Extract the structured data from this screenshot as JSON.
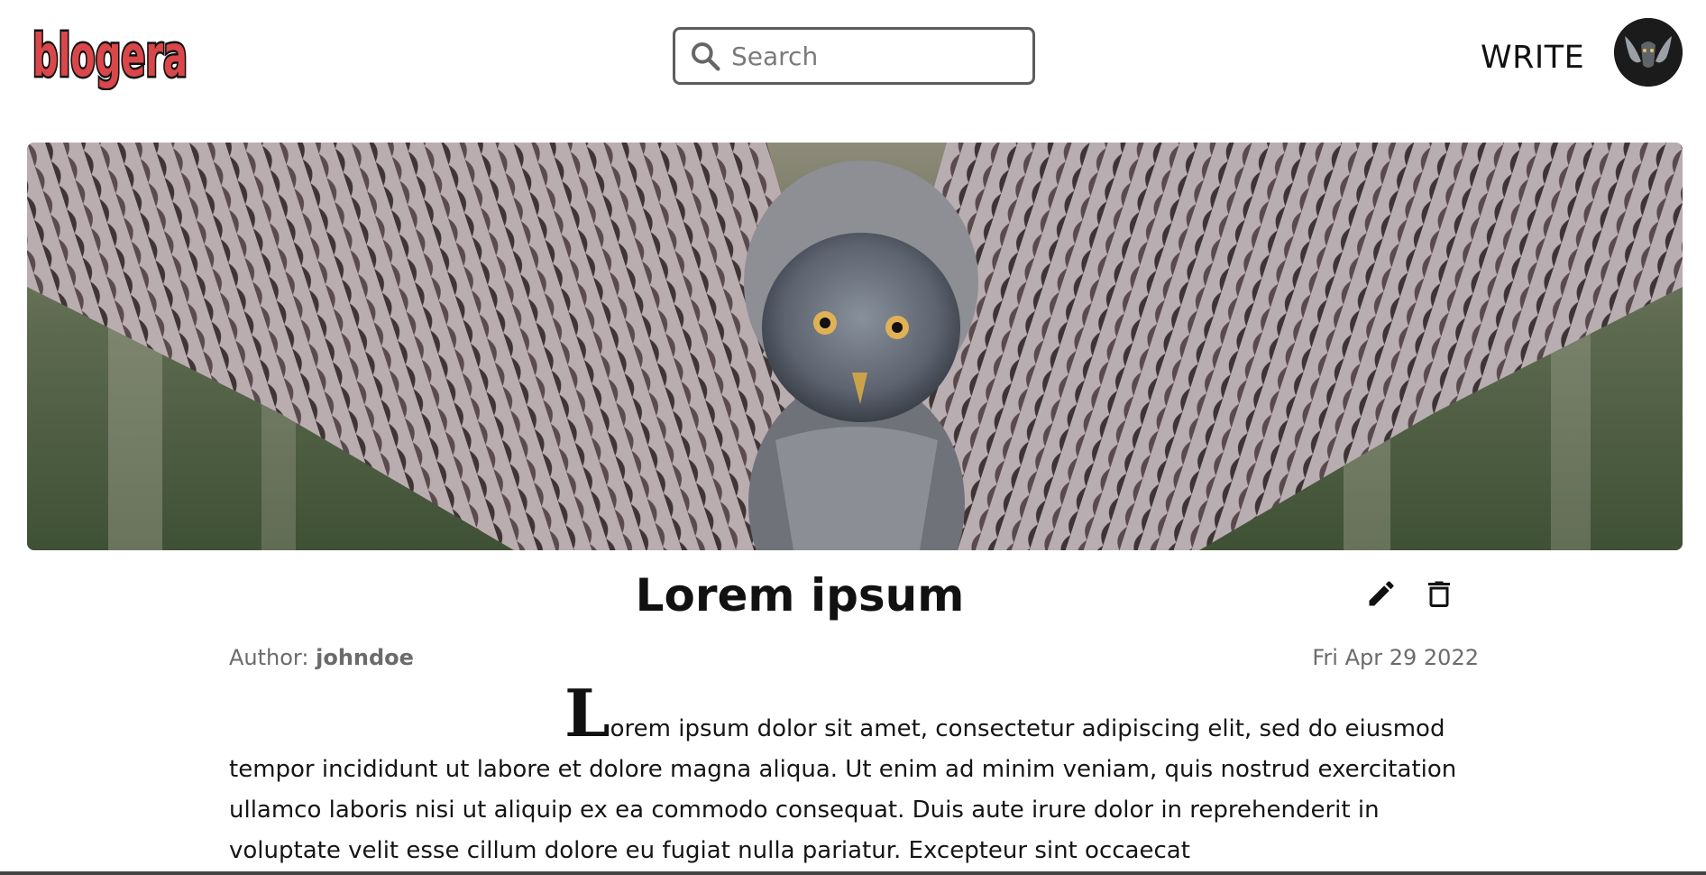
{
  "header": {
    "logo_text": "blogera",
    "search": {
      "placeholder": "Search",
      "value": ""
    },
    "write_label": "WRITE"
  },
  "post": {
    "title": "Lorem ipsum",
    "author_label": "Author:",
    "author_name": "johndoe",
    "date": "Fri Apr 29 2022",
    "dropcap": "L",
    "body": "orem ipsum dolor sit amet, consectetur adipiscing elit, sed do eiusmod tempor incididunt ut labore et dolore magna aliqua. Ut enim ad minim veniam, quis nostrud exercitation ullamco laboris nisi ut aliquip ex ea commodo consequat. Duis aute irure dolor in reprehenderit in voluptate velit esse cillum dolore eu fugiat nulla pariatur. Excepteur sint occaecat"
  },
  "icons": {
    "search": "search-icon",
    "edit": "pencil-icon",
    "delete": "trash-icon",
    "avatar": "owl-avatar"
  },
  "colors": {
    "logo_fill": "#d9474a",
    "logo_outline": "#111111",
    "search_border": "#5c5c5c",
    "meta_text": "#6b6b6b",
    "hero_background": "#4f5c46"
  }
}
